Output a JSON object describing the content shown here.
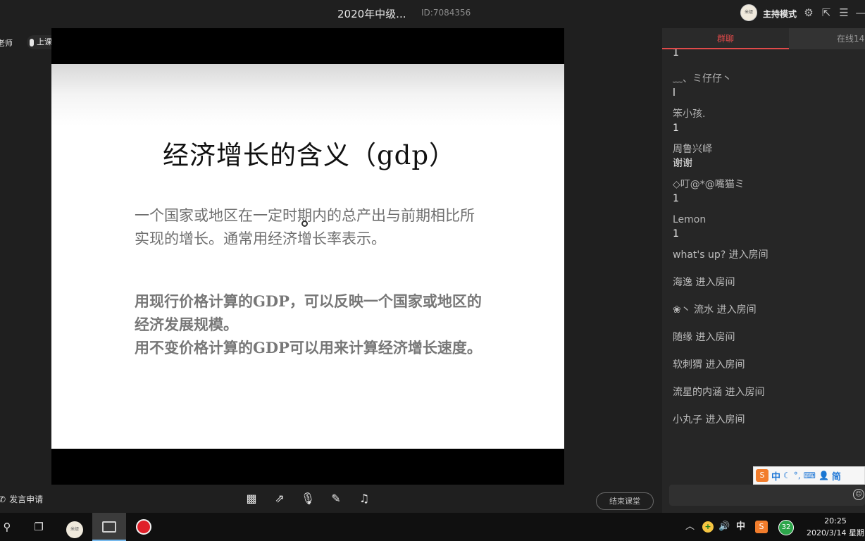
{
  "titlebar": {
    "title": "2020年中级...",
    "room_id": "ID:7084356",
    "host_avatar_text": "米缇",
    "mode_label": "主持模式"
  },
  "stage": {
    "teacher_tag": "老师",
    "class_status": "上课中"
  },
  "slide": {
    "title": "经济增长的含义（gdp）",
    "paragraph1": "一个国家或地区在一定时期内的总产出与前期相比所实现的增长。通常用经济增长率表示。",
    "paragraph2_line1": " 用现行价格计算的GDP，可以反映一个国家或地区的经济发展规模。",
    "paragraph2_line2": "用不变价格计算的GDP可以用来计算经济增长速度。"
  },
  "bottom_bar": {
    "speak_label": "发言申请",
    "end_class_label": "结束课堂"
  },
  "chat": {
    "tab_group": "群聊",
    "tab_online": "在线14",
    "first_text": "1",
    "messages": [
      {
        "name": "﹏、ミ仔仔丶",
        "text": "l"
      },
      {
        "name": "笨小孩.",
        "text": "1"
      },
      {
        "name": "周鲁兴峄",
        "text": "谢谢"
      },
      {
        "name": "◇叮@*@嘴猫ミ",
        "text": "1"
      },
      {
        "name": "Lemon",
        "text": "1"
      }
    ],
    "joins": [
      "what's  up? 进入房间",
      "海逸 进入房间",
      "❀丶 流水 进入房间",
      "随缘 进入房间",
      "软刺猬 进入房间",
      "流星的内涵 进入房间",
      "小丸子 进入房间"
    ]
  },
  "ime": {
    "logo": "S",
    "lang": "中",
    "mode": "简"
  },
  "taskbar": {
    "ime_indicator": "中",
    "badge_count": "32",
    "time": "20:25",
    "date": "2020/3/14 星期"
  },
  "colors": {
    "accent_red": "#e04a4a",
    "record_red": "#e0202a",
    "ime_blue": "#1f77d6"
  }
}
